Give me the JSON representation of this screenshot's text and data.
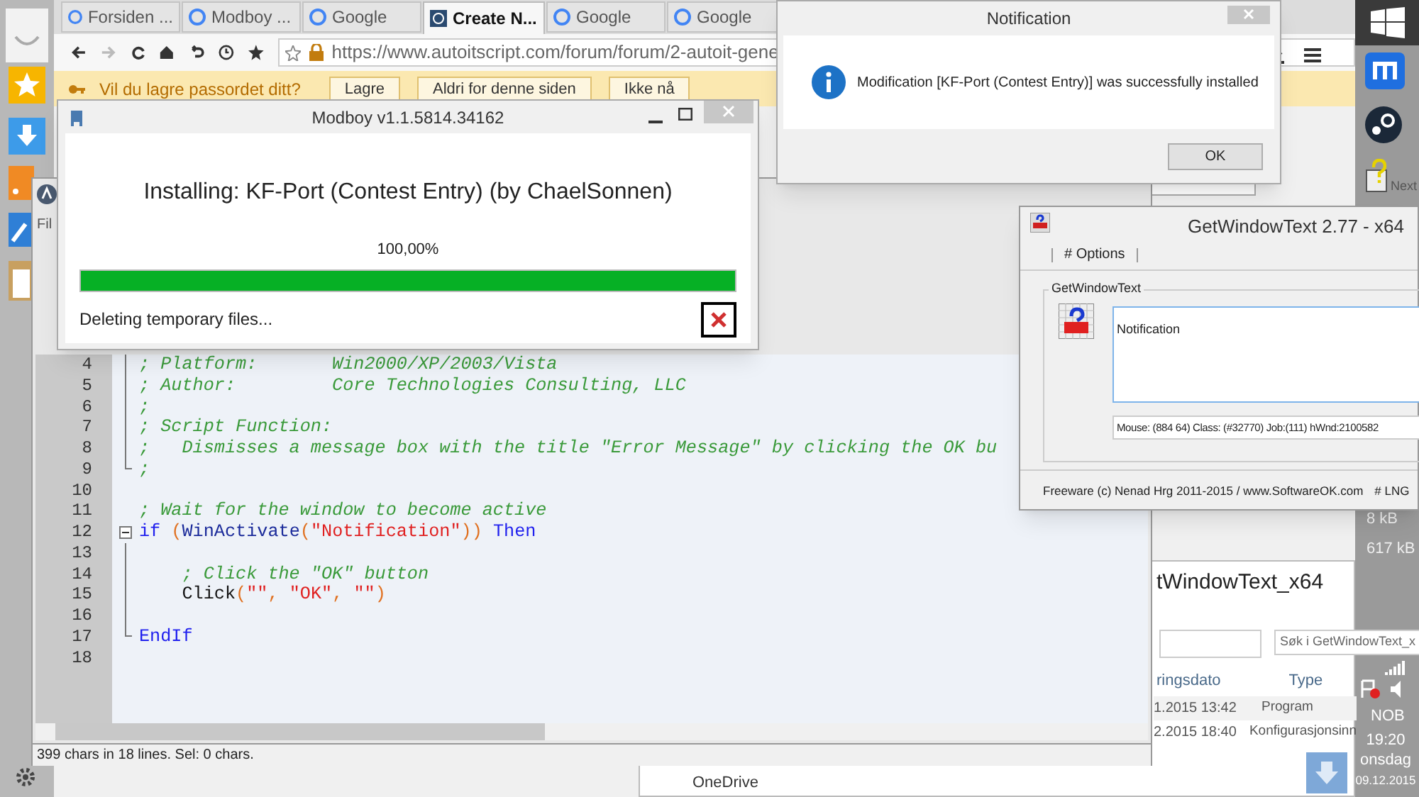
{
  "browser": {
    "tabs": [
      {
        "label": "Forsiden ...",
        "selected": false
      },
      {
        "label": "Modboy ...",
        "selected": false
      },
      {
        "label": "Google",
        "selected": false
      },
      {
        "label": "Create N...",
        "selected": true
      },
      {
        "label": "Google",
        "selected": false
      },
      {
        "label": "Google",
        "selected": false
      }
    ],
    "url": "https://www.autoitscript.com/forum/forum/2-autoit-gene",
    "password_bar": {
      "prompt": "Vil du lagre passordet ditt?",
      "buttons": [
        "Lagre",
        "Aldri for denne siden",
        "Ikke nå"
      ]
    }
  },
  "editor": {
    "menu_fragment": "Fil",
    "lines": [
      {
        "number": "4",
        "kind": "fold_body",
        "tokens": [
          {
            "kind": "comment",
            "text": "; Platform:       Win2000/XP/2003/Vista"
          }
        ]
      },
      {
        "number": "5",
        "kind": "fold_body",
        "tokens": [
          {
            "kind": "comment",
            "text": "; Author:         Core Technologies Consulting, LLC"
          }
        ]
      },
      {
        "number": "6",
        "kind": "fold_body",
        "tokens": [
          {
            "kind": "comment",
            "text": ";"
          }
        ]
      },
      {
        "number": "7",
        "kind": "fold_body",
        "tokens": [
          {
            "kind": "comment",
            "text": "; Script Function:"
          }
        ]
      },
      {
        "number": "8",
        "kind": "fold_body",
        "tokens": [
          {
            "kind": "comment",
            "text": ";   Dismisses a message box with the title \"Error Message\" by clicking the OK bu"
          }
        ]
      },
      {
        "number": "9",
        "kind": "fold_end",
        "tokens": [
          {
            "kind": "comment",
            "text": ";"
          }
        ]
      },
      {
        "number": "10",
        "kind": "plain"
      },
      {
        "number": "11",
        "kind": "plain",
        "tokens": [
          {
            "kind": "comment",
            "text": "; Wait for the window to become active"
          }
        ]
      },
      {
        "number": "12",
        "kind": "fold_start",
        "tokens": [
          {
            "kind": "keyword",
            "text": "if"
          },
          {
            "kind": "operator",
            "text": " ("
          },
          {
            "kind": "function",
            "text": "WinActivate"
          },
          {
            "kind": "operator",
            "text": "("
          },
          {
            "kind": "string",
            "text": "\"Notification\""
          },
          {
            "kind": "operator",
            "text": "))"
          },
          {
            "kind": "keyword",
            "text": " Then"
          }
        ]
      },
      {
        "number": "13",
        "kind": "fold_body"
      },
      {
        "number": "14",
        "kind": "fold_body",
        "tokens": [
          {
            "kind": "comment",
            "text": "    ; Click the \"OK\" button"
          }
        ]
      },
      {
        "number": "15",
        "kind": "fold_body",
        "tokens": [
          {
            "kind": "plain",
            "text": "    Click"
          },
          {
            "kind": "operator",
            "text": "("
          },
          {
            "kind": "string",
            "text": "\"\""
          },
          {
            "kind": "operator",
            "text": ", "
          },
          {
            "kind": "string",
            "text": "\"OK\""
          },
          {
            "kind": "operator",
            "text": ", "
          },
          {
            "kind": "string",
            "text": "\"\""
          },
          {
            "kind": "operator",
            "text": ")"
          }
        ]
      },
      {
        "number": "16",
        "kind": "fold_body"
      },
      {
        "number": "17",
        "kind": "fold_end",
        "tokens": [
          {
            "kind": "keyword",
            "text": "EndIf"
          }
        ]
      },
      {
        "number": "18",
        "kind": "plain"
      }
    ],
    "status_bar": "399 chars in 18 lines. Sel: 0 chars."
  },
  "installer": {
    "title": "Modboy v1.1.5814.34162",
    "heading": "Installing: KF-Port (Contest Entry) (by ChaelSonnen)",
    "percent": "100,00%",
    "level": 1,
    "status": "Deleting temporary files..."
  },
  "notification": {
    "title": "Notification",
    "message": "Modification [KF-Port (Contest Entry)] was successfully installed",
    "button": "OK"
  },
  "get_window_text": {
    "title": "GetWindowText 2.77 - x64",
    "menu": "# Options",
    "group_label": "GetWindowText",
    "text_value": "Notification",
    "info": "Mouse: (884 64) Class: (#32770) Job:(111) hWnd:2100582",
    "footer": "Freeware (c) Nenad Hrg 2011-2015 / www.SoftwareOK.com",
    "footer_right": "# LNG"
  },
  "explorer": {
    "title": "tWindowText_x64",
    "search_placeholder": "Søk i GetWindowText_x",
    "columns": [
      "ringsdato",
      "Type"
    ],
    "rows": [
      [
        "1.2015 13:42",
        "Program"
      ],
      [
        "2.2015 18:40",
        "Konfigurasjonsinn"
      ]
    ],
    "sidebar_item": "OneDrive"
  },
  "taskbar": {
    "find_next": "Next",
    "sizes": [
      "8 kB",
      "617 kB"
    ],
    "language": "NOB",
    "time": "19:20",
    "day": "onsdag",
    "date": "09.12.2015"
  }
}
